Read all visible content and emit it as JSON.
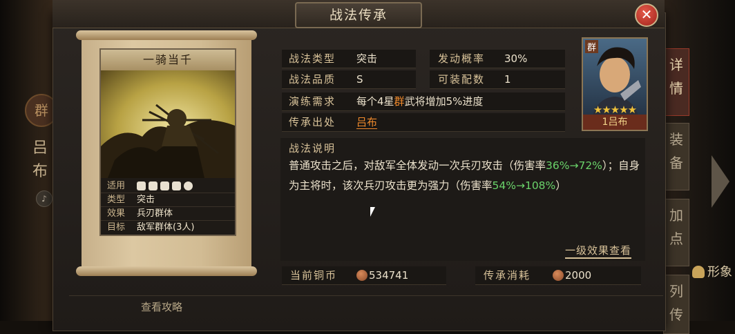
{
  "dialog": {
    "title": "战法传承",
    "close_label": "✕"
  },
  "background": {
    "faction_char": "群",
    "name_chars": [
      "吕",
      "布"
    ],
    "speaker_icon": "♪",
    "side_tabs": [
      "详情",
      "装备",
      "加点",
      "列传"
    ],
    "form_label": "形象"
  },
  "skill_card": {
    "name": "一骑当千",
    "rows": [
      {
        "key": "适用",
        "value": ""
      },
      {
        "key": "类型",
        "value": "突击"
      },
      {
        "key": "效果",
        "value": "兵刃群体"
      },
      {
        "key": "目标",
        "value": "敌军群体(3人)"
      }
    ],
    "troop_icons": [
      "cavalry-icon",
      "shield-icon",
      "bow-icon",
      "spear-icon",
      "chariot-icon"
    ]
  },
  "info": {
    "type_label": "战法类型",
    "type_value": "突击",
    "prob_label": "发动概率",
    "prob_value": "30%",
    "quality_label": "战法品质",
    "quality_value": "S",
    "equip_label": "可装配数",
    "equip_value": "1",
    "train_label": "演练需求",
    "train_value_pre": "每个4星",
    "train_value_faction": "群",
    "train_value_post": "武将增加5%进度",
    "source_label": "传承出处",
    "source_value": "吕布"
  },
  "general": {
    "faction": "群",
    "stars": "★★★★★",
    "star_count": 5,
    "name": "1吕布"
  },
  "description": {
    "title": "战法说明",
    "p1": "普通攻击之后，对敌军全体发动一次兵刃攻击（伤害率",
    "g1": "36%→72%",
    "p2": "）；自身为主将时，该次兵刃攻击更为强力（伤害率",
    "g2": "54%→108%",
    "p3": "）",
    "link": "一级效果查看"
  },
  "resources": {
    "copper_label": "当前铜币",
    "copper_value": "534741",
    "cost_label": "传承消耗",
    "cost_value": "2000"
  },
  "footer": {
    "guide_label": "查看攻略"
  },
  "colors": {
    "accent_orange": "#f08a2c",
    "value_green": "#6ad36a",
    "close_red": "#c0342a"
  }
}
